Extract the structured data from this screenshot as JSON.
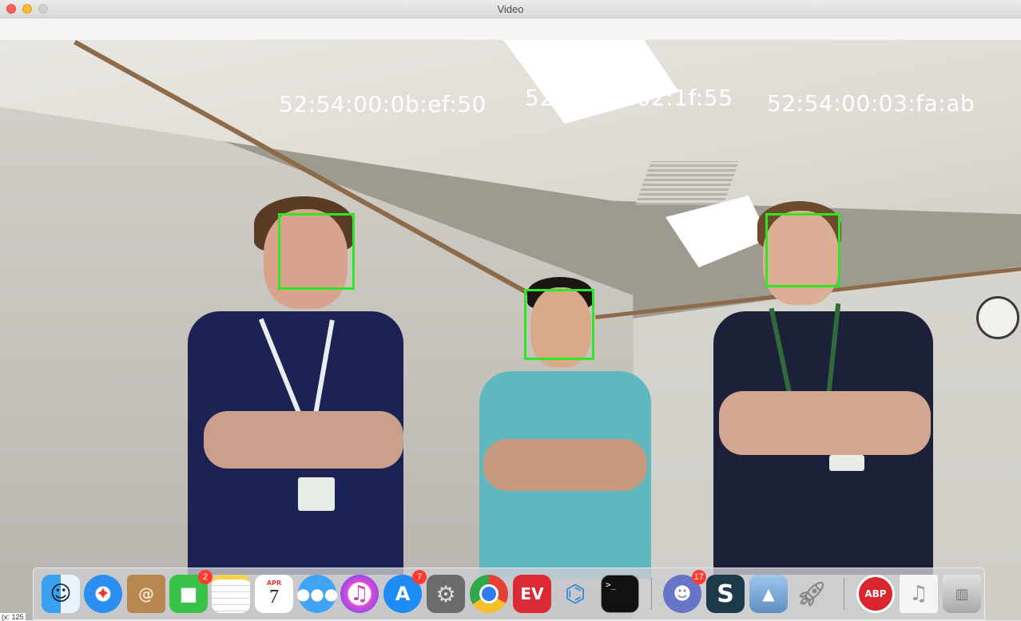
{
  "window": {
    "title": "Video"
  },
  "video": {
    "labels": [
      "52:54:00:0b:ef:50",
      "52:54:00:02:1f:55",
      "52:54:00:03:fa:ab"
    ],
    "box_color": "#2ee624"
  },
  "dock": {
    "apps": [
      {
        "name": "Finder",
        "icon": "finder-icon"
      },
      {
        "name": "Safari",
        "icon": "safari-icon"
      },
      {
        "name": "Contacts",
        "icon": "contacts-icon"
      },
      {
        "name": "FaceTime",
        "icon": "facetime-icon",
        "badge": "2"
      },
      {
        "name": "Notes",
        "icon": "notes-icon"
      },
      {
        "name": "Calendar",
        "icon": "calendar-icon",
        "month": "APR",
        "day": "7"
      },
      {
        "name": "Messages",
        "icon": "messages-icon"
      },
      {
        "name": "iTunes",
        "icon": "itunes-icon"
      },
      {
        "name": "App Store",
        "icon": "app-store-icon",
        "badge": "7"
      },
      {
        "name": "System Preferences",
        "icon": "system-preferences-icon"
      },
      {
        "name": "Chrome",
        "icon": "chrome-icon"
      },
      {
        "name": "ExpressVPN",
        "icon": "expressvpn-icon"
      },
      {
        "name": "VS Code",
        "icon": "vscode-icon"
      },
      {
        "name": "Terminal",
        "icon": "terminal-icon"
      },
      {
        "name": "Discord",
        "icon": "discord-icon",
        "badge": "17"
      },
      {
        "name": "Sublime",
        "icon": "sublime-icon"
      },
      {
        "name": "Preview",
        "icon": "preview-icon"
      },
      {
        "name": "Launchpad",
        "icon": "launchpad-icon"
      },
      {
        "name": "AdBlock Plus",
        "icon": "adblock-icon",
        "label": "ABP"
      },
      {
        "name": "Music File",
        "icon": "music-file-icon"
      },
      {
        "name": "Trash",
        "icon": "trash-icon"
      }
    ]
  },
  "status_text": "(x: 125"
}
